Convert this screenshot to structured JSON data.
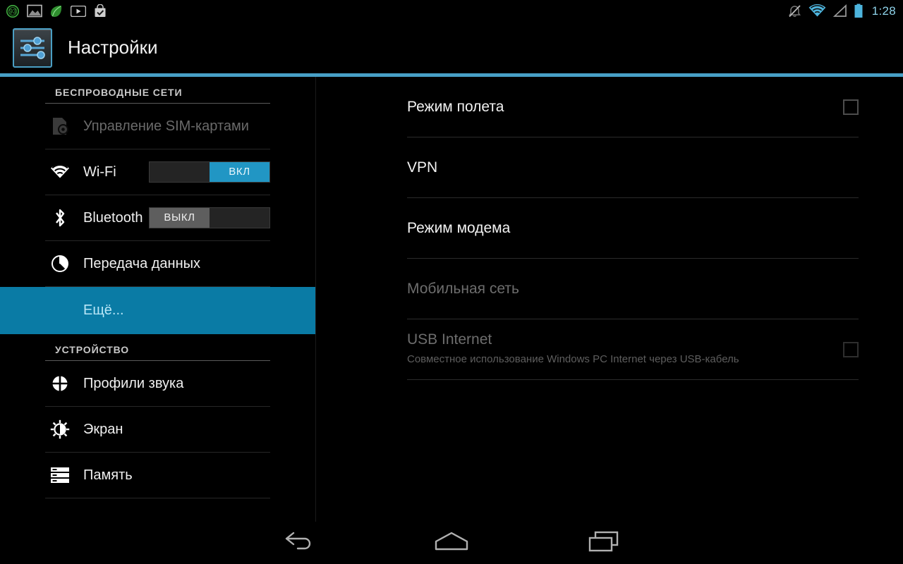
{
  "status_bar": {
    "left_icons": [
      {
        "name": "battery-percent-badge-icon",
        "value": "93"
      },
      {
        "name": "gallery-icon"
      },
      {
        "name": "leaf-app-icon"
      },
      {
        "name": "youtube-icon"
      },
      {
        "name": "checkmark-bag-icon"
      }
    ],
    "right_icons": [
      {
        "name": "ringer-muted-icon"
      },
      {
        "name": "wifi-icon"
      },
      {
        "name": "cellular-signal-icon"
      },
      {
        "name": "battery-icon"
      }
    ],
    "clock": "1:28"
  },
  "action_bar": {
    "app_icon": "settings-sliders-icon",
    "title": "Настройки"
  },
  "colors": {
    "accent": "#479fc6",
    "selected_row": "#0a7ba5",
    "switch_on": "#2196c4",
    "switch_off": "#5e5e5e",
    "clock": "#8fd3ea",
    "battery_badge": "#3fae3f"
  },
  "sidebar": {
    "sections": [
      {
        "header": "БЕСПРОВОДНЫЕ СЕТИ",
        "items": [
          {
            "label": "Управление SIM-картами",
            "icon": "sim-card-icon",
            "state": "disabled",
            "control": "none"
          },
          {
            "label": "Wi-Fi",
            "icon": "wifi-icon",
            "state": "normal",
            "control": "switch",
            "switch_state": "on",
            "switch_label": "ВКЛ"
          },
          {
            "label": "Bluetooth",
            "icon": "bluetooth-icon",
            "state": "normal",
            "control": "switch",
            "switch_state": "off",
            "switch_label": "ВЫКЛ"
          },
          {
            "label": "Передача данных",
            "icon": "data-usage-pie-icon",
            "state": "normal",
            "control": "none"
          },
          {
            "label": "Ещё...",
            "icon": "none",
            "state": "selected",
            "control": "none"
          }
        ]
      },
      {
        "header": "УСТРОЙСТВО",
        "items": [
          {
            "label": "Профили звука",
            "icon": "audio-profiles-icon",
            "state": "normal",
            "control": "none"
          },
          {
            "label": "Экран",
            "icon": "display-brightness-icon",
            "state": "normal",
            "control": "none"
          },
          {
            "label": "Память",
            "icon": "storage-icon",
            "state": "normal",
            "control": "none"
          }
        ]
      }
    ]
  },
  "content": {
    "preferences": [
      {
        "title": "Режим полета",
        "summary": "",
        "state": "normal",
        "control": "checkbox",
        "checked": false
      },
      {
        "title": "VPN",
        "summary": "",
        "state": "normal",
        "control": "none"
      },
      {
        "title": "Режим модема",
        "summary": "",
        "state": "normal",
        "control": "none"
      },
      {
        "title": "Мобильная сеть",
        "summary": "",
        "state": "disabled",
        "control": "none"
      },
      {
        "title": "USB Internet",
        "summary": "Совместное использование Windows PC Internet через USB-кабель",
        "state": "disabled",
        "control": "checkbox",
        "checked": false
      }
    ]
  },
  "nav_bar": {
    "buttons": [
      {
        "name": "back-button",
        "icon": "back-arrow-icon"
      },
      {
        "name": "home-button",
        "icon": "home-icon"
      },
      {
        "name": "recents-button",
        "icon": "recent-apps-icon"
      }
    ]
  }
}
